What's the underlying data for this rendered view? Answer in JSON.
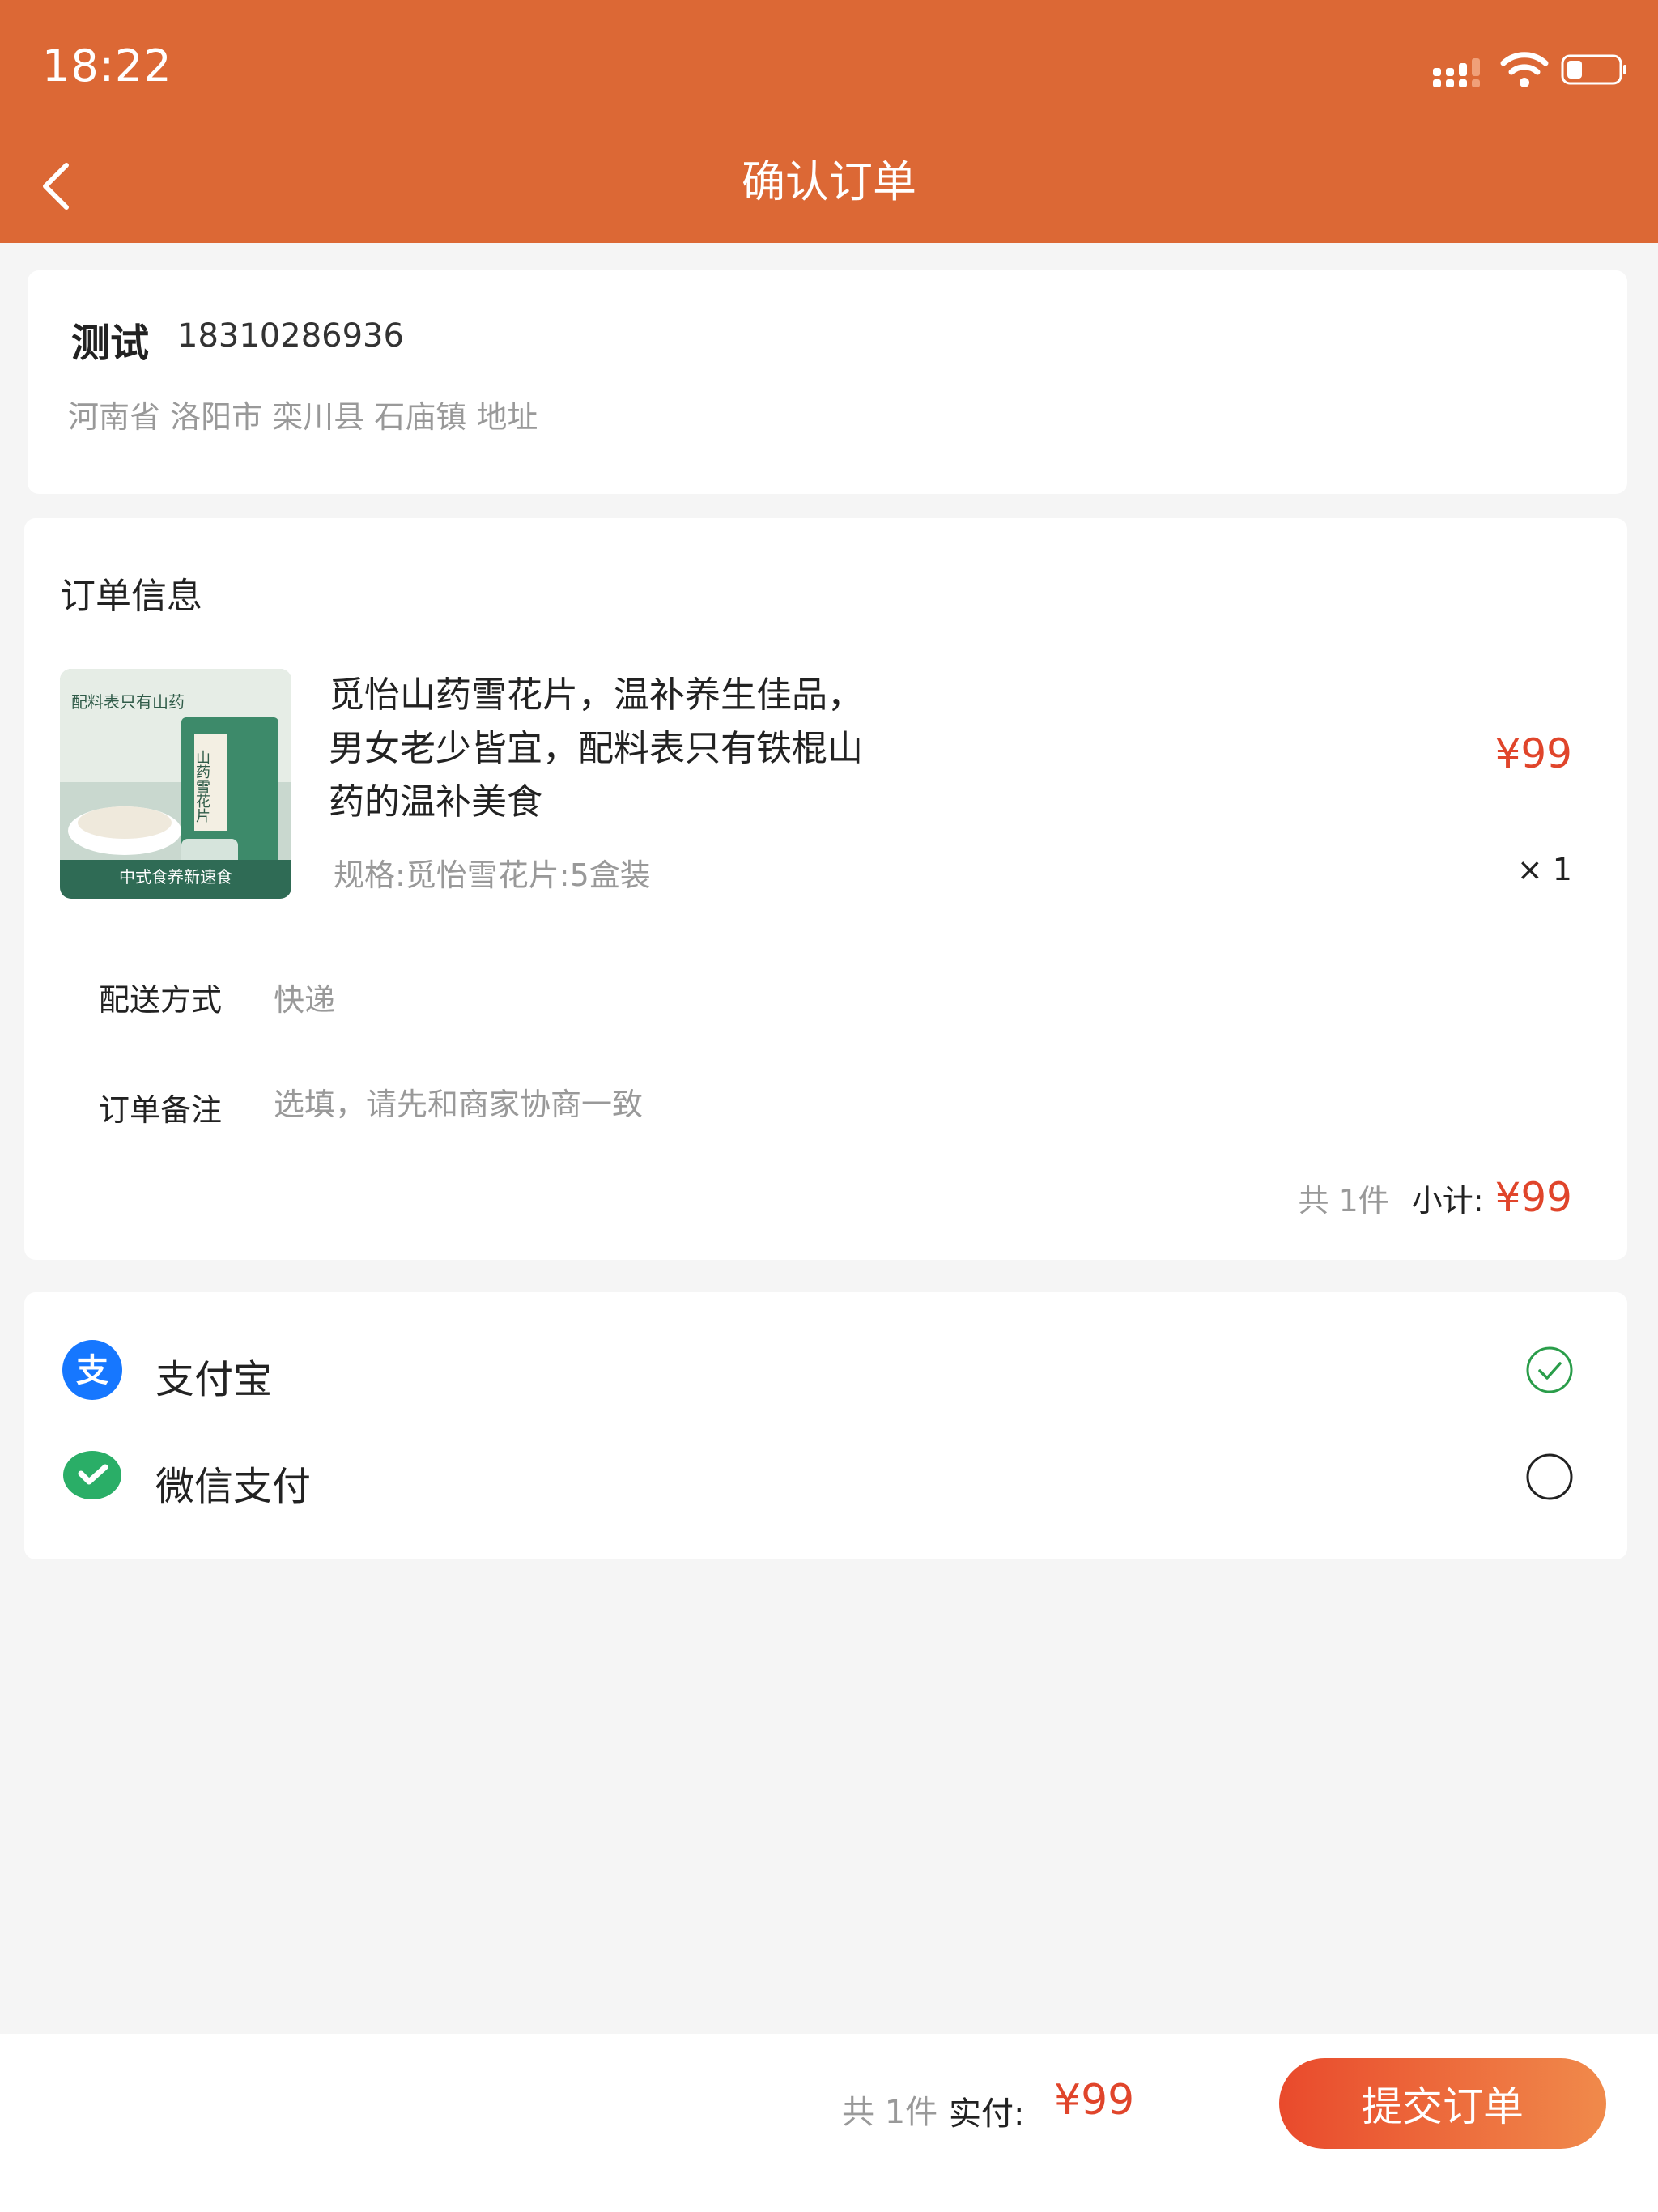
{
  "status_bar": {
    "time": "18:22"
  },
  "header": {
    "title": "确认订单"
  },
  "address": {
    "name": "测试",
    "phone": "18310286936",
    "detail": "河南省 洛阳市 栾川县 石庙镇 地址"
  },
  "order": {
    "section_title": "订单信息",
    "product": {
      "name": "觅怡山药雪花片，温补养生佳品，男女老少皆宜，配料表只有铁棍山药的温补美食",
      "price": "¥99",
      "spec": "规格:觅怡雪花片:5盒装",
      "qty": "× 1",
      "image_caption_top": "配料表只有山药",
      "image_caption_box": "山药雪花片",
      "image_caption_bottom": "中式食养新速食"
    },
    "delivery": {
      "label": "配送方式",
      "value": "快递"
    },
    "remark": {
      "label": "订单备注",
      "placeholder": "选填，请先和商家协商一致"
    },
    "subtotal": {
      "count": "共 1件",
      "label": "小计:",
      "amount": "¥99"
    }
  },
  "payment": {
    "methods": [
      {
        "label": "支付宝",
        "icon": "alipay-icon",
        "selected": true,
        "color": "#1677ff"
      },
      {
        "label": "微信支付",
        "icon": "wechat-pay-icon",
        "selected": false,
        "color": "#2aae67"
      }
    ]
  },
  "bottom": {
    "count": "共 1件",
    "label": "实付:",
    "amount": "¥99",
    "submit_label": "提交订单"
  },
  "colors": {
    "brand": "#dc6835",
    "price": "#e0452b",
    "check": "#2a9d4a"
  }
}
